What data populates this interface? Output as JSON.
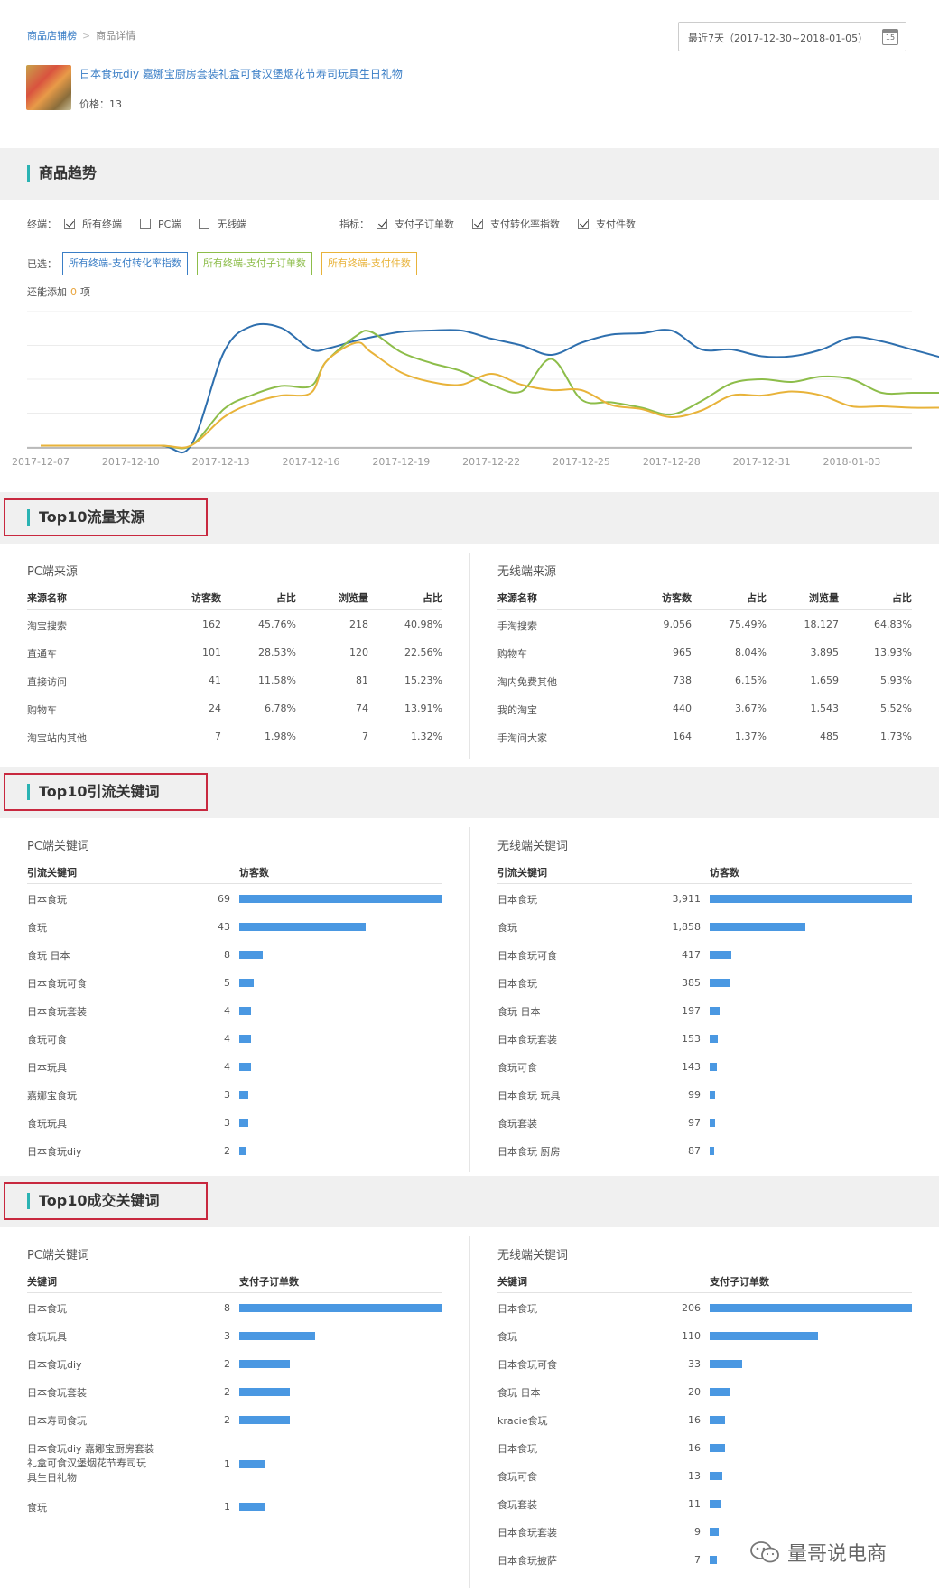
{
  "breadcrumb": {
    "root": "商品店铺榜",
    "sep": ">",
    "current": "商品详情"
  },
  "date_range": {
    "label": "最近7天（2017-12-30~2018-01-05）",
    "icon": "calendar-icon",
    "icon_text": "15"
  },
  "product": {
    "title": "日本食玩diy 嘉娜宝厨房套装礼盒可食汉堡烟花节寿司玩具生日礼物",
    "price": "价格：13"
  },
  "trend": {
    "section_title": "商品趋势",
    "terminal_label": "终端：",
    "terminals": [
      {
        "label": "所有终端",
        "checked": true
      },
      {
        "label": "PC端",
        "checked": false
      },
      {
        "label": "无线端",
        "checked": false
      }
    ],
    "metric_label": "指标：",
    "metrics": [
      {
        "label": "支付子订单数",
        "checked": true
      },
      {
        "label": "支付转化率指数",
        "checked": true
      },
      {
        "label": "支付件数",
        "checked": true
      }
    ],
    "selected_label": "已选：",
    "selected": [
      {
        "label": "所有终端-支付转化率指数",
        "color": "#3a7ec6"
      },
      {
        "label": "所有终端-支付子订单数",
        "color": "#8dbd4a"
      },
      {
        "label": "所有终端-支付件数",
        "color": "#e8b33a"
      }
    ],
    "remain_prefix": "还能添加",
    "remain_count": "0",
    "remain_suffix": "项"
  },
  "chart_data": {
    "type": "line",
    "title": "",
    "xlabel": "",
    "ylabel": "",
    "x_ticks": [
      "2017-12-07",
      "2017-12-10",
      "2017-12-13",
      "2017-12-16",
      "2017-12-19",
      "2017-12-22",
      "2017-12-25",
      "2017-12-28",
      "2017-12-31",
      "2018-01-03"
    ],
    "x_start": "2017-12-07",
    "x_end": "2018-01-05",
    "ylim": [
      0,
      100
    ],
    "grid": true,
    "legend": "none",
    "series": [
      {
        "name": "所有终端-支付转化率指数",
        "color": "#2e6fae",
        "values": [
          [
            0,
            1
          ],
          [
            2,
            1
          ],
          [
            4,
            1
          ],
          [
            5,
            1
          ],
          [
            6.1,
            70
          ],
          [
            7,
            89
          ],
          [
            8,
            88
          ],
          [
            9,
            72
          ],
          [
            9.6,
            73
          ],
          [
            10.4,
            78
          ],
          [
            11,
            81
          ],
          [
            12,
            85
          ],
          [
            13,
            86
          ],
          [
            14,
            86
          ],
          [
            15,
            80
          ],
          [
            16,
            75
          ],
          [
            17,
            68
          ],
          [
            18,
            77
          ],
          [
            19,
            83
          ],
          [
            20,
            84
          ],
          [
            21,
            86
          ],
          [
            22,
            72
          ],
          [
            23,
            72
          ],
          [
            24,
            67
          ],
          [
            25,
            67
          ],
          [
            26,
            72
          ],
          [
            27,
            81
          ],
          [
            28,
            78
          ],
          [
            29,
            72
          ],
          [
            30,
            66
          ]
        ]
      },
      {
        "name": "所有终端-支付子订单数",
        "color": "#8dbd4a",
        "values": [
          [
            0,
            1
          ],
          [
            2,
            1
          ],
          [
            4,
            1
          ],
          [
            5,
            1
          ],
          [
            6.1,
            28
          ],
          [
            7,
            38
          ],
          [
            8,
            45
          ],
          [
            9,
            45
          ],
          [
            9.5,
            63
          ],
          [
            10.5,
            82
          ],
          [
            11,
            85
          ],
          [
            12,
            70
          ],
          [
            13,
            62
          ],
          [
            14,
            56
          ],
          [
            15,
            46
          ],
          [
            16,
            41
          ],
          [
            17,
            65
          ],
          [
            18,
            35
          ],
          [
            19,
            33
          ],
          [
            20,
            29
          ],
          [
            21,
            24
          ],
          [
            22,
            34
          ],
          [
            23,
            47
          ],
          [
            24,
            50
          ],
          [
            25,
            48
          ],
          [
            26,
            52
          ],
          [
            27,
            50
          ],
          [
            28,
            40
          ],
          [
            29,
            40
          ],
          [
            30,
            40
          ]
        ]
      },
      {
        "name": "所有终端-支付件数",
        "color": "#e8b33a",
        "values": [
          [
            0,
            1
          ],
          [
            2,
            1
          ],
          [
            4,
            1
          ],
          [
            5,
            1
          ],
          [
            6.1,
            22
          ],
          [
            7,
            32
          ],
          [
            8,
            38
          ],
          [
            9,
            40
          ],
          [
            9.5,
            63
          ],
          [
            10.5,
            77
          ],
          [
            11,
            70
          ],
          [
            12,
            55
          ],
          [
            13,
            48
          ],
          [
            14,
            46
          ],
          [
            15,
            54
          ],
          [
            16,
            46
          ],
          [
            17,
            42
          ],
          [
            18,
            42
          ],
          [
            19,
            31
          ],
          [
            20,
            28
          ],
          [
            21,
            22
          ],
          [
            22,
            27
          ],
          [
            23,
            38
          ],
          [
            24,
            38
          ],
          [
            25,
            41
          ],
          [
            26,
            38
          ],
          [
            27,
            30
          ],
          [
            28,
            30
          ],
          [
            29,
            29
          ],
          [
            30,
            29
          ]
        ]
      }
    ]
  },
  "traffic": {
    "section_title": "Top10流量来源",
    "pc": {
      "title": "PC端来源",
      "headers": [
        "来源名称",
        "访客数",
        "占比",
        "浏览量",
        "占比"
      ],
      "rows": [
        [
          "淘宝搜索",
          "162",
          "45.76%",
          "218",
          "40.98%"
        ],
        [
          "直通车",
          "101",
          "28.53%",
          "120",
          "22.56%"
        ],
        [
          "直接访问",
          "41",
          "11.58%",
          "81",
          "15.23%"
        ],
        [
          "购物车",
          "24",
          "6.78%",
          "74",
          "13.91%"
        ],
        [
          "淘宝站内其他",
          "7",
          "1.98%",
          "7",
          "1.32%"
        ]
      ]
    },
    "mobile": {
      "title": "无线端来源",
      "headers": [
        "来源名称",
        "访客数",
        "占比",
        "浏览量",
        "占比"
      ],
      "rows": [
        [
          "手淘搜索",
          "9,056",
          "75.49%",
          "18,127",
          "64.83%"
        ],
        [
          "购物车",
          "965",
          "8.04%",
          "3,895",
          "13.93%"
        ],
        [
          "淘内免费其他",
          "738",
          "6.15%",
          "1,659",
          "5.93%"
        ],
        [
          "我的淘宝",
          "440",
          "3.67%",
          "1,543",
          "5.52%"
        ],
        [
          "手淘问大家",
          "164",
          "1.37%",
          "485",
          "1.73%"
        ]
      ]
    }
  },
  "keywords": {
    "section_title": "Top10引流关键词",
    "pc": {
      "title": "PC端关键词",
      "headers": [
        "引流关键词",
        "访客数"
      ],
      "rows": [
        {
          "k": "日本食玩",
          "v": "69",
          "n": 69
        },
        {
          "k": "食玩",
          "v": "43",
          "n": 43
        },
        {
          "k": "食玩 日本",
          "v": "8",
          "n": 8
        },
        {
          "k": "日本食玩可食",
          "v": "5",
          "n": 5
        },
        {
          "k": "日本食玩套装",
          "v": "4",
          "n": 4
        },
        {
          "k": "食玩可食",
          "v": "4",
          "n": 4
        },
        {
          "k": "日本玩具",
          "v": "4",
          "n": 4
        },
        {
          "k": "嘉娜宝食玩",
          "v": "3",
          "n": 3
        },
        {
          "k": "食玩玩具",
          "v": "3",
          "n": 3
        },
        {
          "k": "日本食玩diy",
          "v": "2",
          "n": 2
        }
      ]
    },
    "mobile": {
      "title": "无线端关键词",
      "headers": [
        "引流关键词",
        "访客数"
      ],
      "rows": [
        {
          "k": "日本食玩",
          "v": "3,911",
          "n": 3911
        },
        {
          "k": "食玩",
          "v": "1,858",
          "n": 1858
        },
        {
          "k": "日本食玩可食",
          "v": "417",
          "n": 417
        },
        {
          "k": "日本食玩",
          "v": "385",
          "n": 385
        },
        {
          "k": "食玩 日本",
          "v": "197",
          "n": 197
        },
        {
          "k": "日本食玩套装",
          "v": "153",
          "n": 153
        },
        {
          "k": "食玩可食",
          "v": "143",
          "n": 143
        },
        {
          "k": "日本食玩 玩具",
          "v": "99",
          "n": 99
        },
        {
          "k": "食玩套装",
          "v": "97",
          "n": 97
        },
        {
          "k": "日本食玩 厨房",
          "v": "87",
          "n": 87
        }
      ]
    }
  },
  "deals": {
    "section_title": "Top10成交关键词",
    "pc": {
      "title": "PC端关键词",
      "headers": [
        "关键词",
        "支付子订单数"
      ],
      "rows": [
        {
          "k": "日本食玩",
          "v": "8",
          "n": 8
        },
        {
          "k": "食玩玩具",
          "v": "3",
          "n": 3
        },
        {
          "k": "日本食玩diy",
          "v": "2",
          "n": 2
        },
        {
          "k": "日本食玩套装",
          "v": "2",
          "n": 2
        },
        {
          "k": "日本寿司食玩",
          "v": "2",
          "n": 2
        },
        {
          "k": [
            "日本食玩diy 嘉娜宝厨房套装",
            "礼盒可食汉堡烟花节寿司玩",
            "具生日礼物"
          ],
          "v": "1",
          "n": 1
        },
        {
          "k": "食玩",
          "v": "1",
          "n": 1
        }
      ]
    },
    "mobile": {
      "title": "无线端关键词",
      "headers": [
        "关键词",
        "支付子订单数"
      ],
      "rows": [
        {
          "k": "日本食玩",
          "v": "206",
          "n": 206
        },
        {
          "k": "食玩",
          "v": "110",
          "n": 110
        },
        {
          "k": "日本食玩可食",
          "v": "33",
          "n": 33
        },
        {
          "k": "食玩 日本",
          "v": "20",
          "n": 20
        },
        {
          "k": "kracie食玩",
          "v": "16",
          "n": 16
        },
        {
          "k": "日本食玩",
          "v": "16",
          "n": 16
        },
        {
          "k": "食玩可食",
          "v": "13",
          "n": 13
        },
        {
          "k": "食玩套装",
          "v": "11",
          "n": 11
        },
        {
          "k": "日本食玩套装",
          "v": "9",
          "n": 9
        },
        {
          "k": "日本食玩披萨",
          "v": "7",
          "n": 7
        }
      ]
    }
  },
  "watermark": {
    "text": "量哥说电商",
    "icon": "wechat-icon"
  },
  "colors": {
    "accent": "#2bb3b3",
    "highlight_border": "#c8283f",
    "bar": "#4a98e2",
    "section_bg": "#f0f0f0"
  }
}
